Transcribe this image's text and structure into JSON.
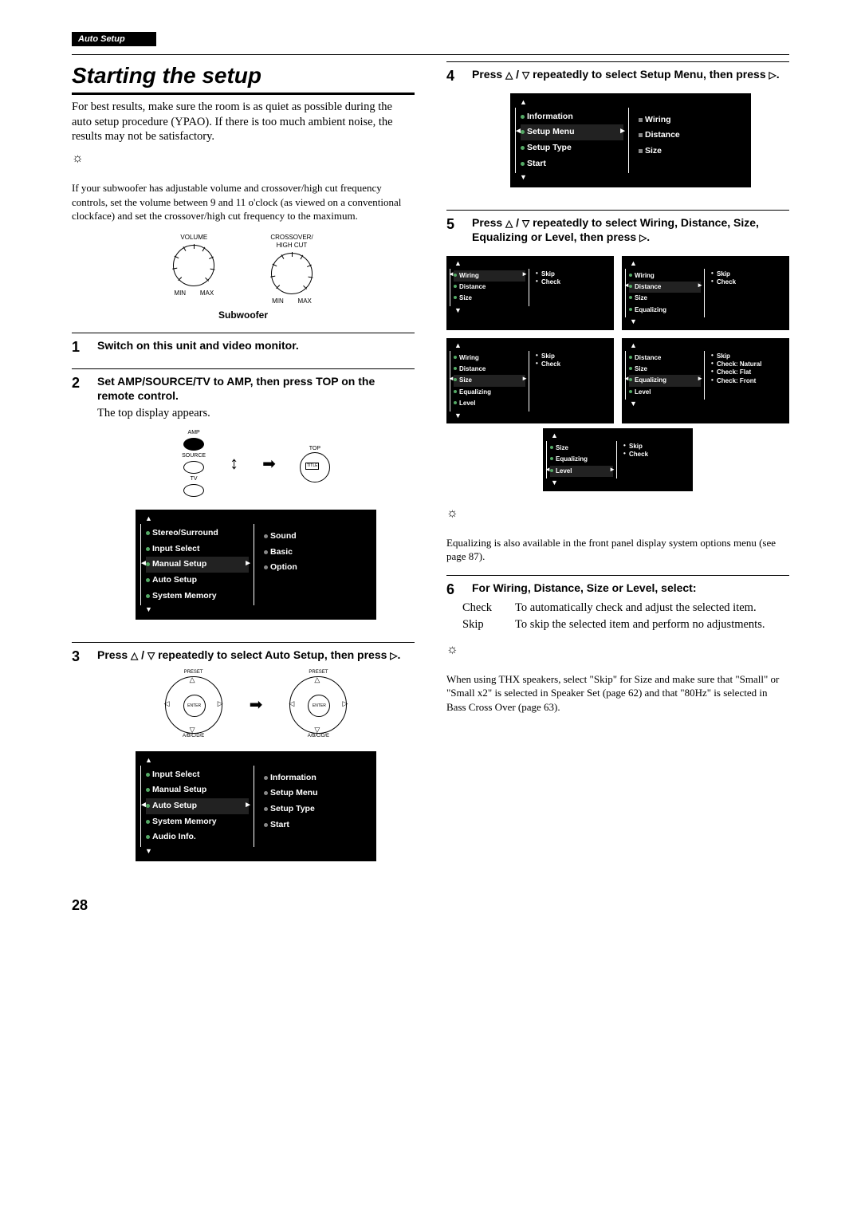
{
  "header": {
    "label": "Auto Setup"
  },
  "title": "Starting the setup",
  "intro": "For best results, make sure the room is as quiet as possible during the auto setup procedure (YPAO). If there is too much ambient noise, the results may not be satisfactory.",
  "tip1": "If your subwoofer has adjustable volume and crossover/high cut frequency controls, set the volume between 9 and 11 o'clock (as viewed on a conventional clockface) and set the crossover/high cut frequency to the maximum.",
  "dial": {
    "volume_label": "VOLUME",
    "crossover_label": "CROSSOVER/\nHIGH CUT",
    "min": "MIN",
    "max": "MAX",
    "subwoofer": "Subwoofer"
  },
  "steps": {
    "s1": {
      "num": "1",
      "heading": "Switch on this unit and video monitor."
    },
    "s2": {
      "num": "2",
      "heading": "Set AMP/SOURCE/TV to AMP, then press TOP on the remote control.",
      "body": "The top display appears.",
      "remote": {
        "amp": "AMP",
        "source": "SOURCE",
        "tv": "TV",
        "top": "TOP",
        "title": "TITLE"
      }
    },
    "s3": {
      "num": "3",
      "heading_a": "Press ",
      "heading_b": " repeatedly to select Auto Setup, then press ",
      "dpad": {
        "preset": "PRESET",
        "enter": "ENTER",
        "ab": "A/B/C/D/E"
      }
    },
    "s4": {
      "num": "4",
      "heading_a": "Press ",
      "heading_b": " repeatedly to select Setup Menu, then press "
    },
    "s5": {
      "num": "5",
      "heading_a": "Press ",
      "heading_b": " repeatedly to select Wiring, Distance, Size, Equalizing or Level, then press ",
      "tip": "Equalizing is also available in the front panel display system options menu (see page 87)."
    },
    "s6": {
      "num": "6",
      "heading": "For Wiring, Distance, Size or Level, select:",
      "check_term": "Check",
      "check_def": "To automatically check and adjust the selected item.",
      "skip_term": "Skip",
      "skip_def": "To skip the selected item and perform no adjustments.",
      "tip": "When using THX speakers, select \"Skip\" for Size and make sure that \"Small\" or \"Small x2\" is selected in Speaker Set (page 62) and that \"80Hz\" is selected in Bass Cross Over (page 63)."
    }
  },
  "osd_top": {
    "left": [
      "Stereo/Surround",
      "Input Select",
      "Manual Setup",
      "Auto Setup",
      "System Memory"
    ],
    "selected": "Manual Setup",
    "right": [
      "Sound",
      "Basic",
      "Option"
    ]
  },
  "osd_auto": {
    "left": [
      "Input Select",
      "Manual Setup",
      "Auto Setup",
      "System Memory",
      "Audio Info."
    ],
    "selected": "Auto Setup",
    "right": [
      "Information",
      "Setup Menu",
      "Setup Type",
      "Start"
    ]
  },
  "osd_setup_menu": {
    "left": [
      "Information",
      "Setup Menu",
      "Setup Type",
      "Start"
    ],
    "selected": "Setup Menu",
    "right": [
      "Wiring",
      "Distance",
      "Size"
    ]
  },
  "osd5": {
    "a": {
      "left": [
        "Wiring",
        "Distance",
        "Size"
      ],
      "sel": "Wiring",
      "right": [
        "Skip",
        "Check"
      ]
    },
    "b": {
      "left": [
        "Wiring",
        "Distance",
        "Size",
        "Equalizing"
      ],
      "sel": "Distance",
      "right": [
        "Skip",
        "Check"
      ]
    },
    "c": {
      "left": [
        "Wiring",
        "Distance",
        "Size",
        "Equalizing",
        "Level"
      ],
      "sel": "Size",
      "right": [
        "Skip",
        "Check"
      ]
    },
    "d": {
      "left": [
        "Distance",
        "Size",
        "Equalizing",
        "Level"
      ],
      "sel": "Equalizing",
      "right": [
        "Skip",
        "Check: Natural",
        "Check: Flat",
        "Check: Front"
      ]
    },
    "e": {
      "left": [
        "Size",
        "Equalizing",
        "Level"
      ],
      "sel": "Level",
      "right": [
        "Skip",
        "Check"
      ]
    }
  },
  "page_number": "28"
}
